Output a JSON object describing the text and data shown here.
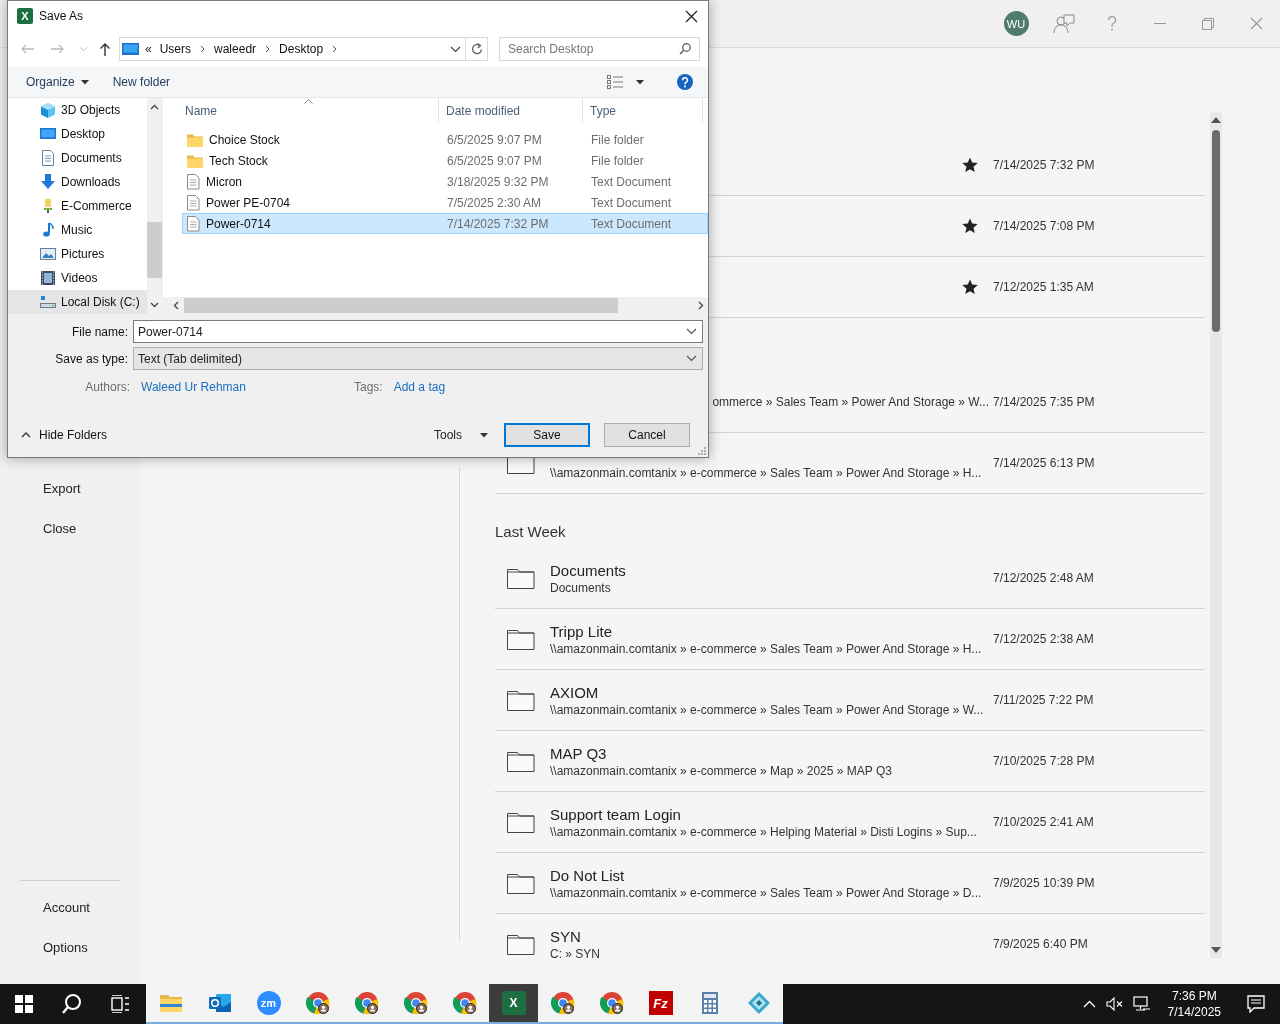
{
  "title_bar": {
    "avatar": "WU"
  },
  "backstage_nav": {
    "items": [
      {
        "label": "Export"
      },
      {
        "label": "Close"
      }
    ],
    "bottom_items": [
      {
        "label": "Account"
      },
      {
        "label": "Options"
      }
    ]
  },
  "recent": {
    "groups": [
      {
        "rows": [
          {
            "kind": "covered",
            "date": "7/14/2025 7:32 PM",
            "pinned": true
          },
          {
            "kind": "covered",
            "date": "7/14/2025 7:08 PM",
            "pinned": true
          },
          {
            "kind": "covered",
            "date": "7/12/2025 1:35 AM",
            "pinned": true
          }
        ]
      },
      {
        "rows": [
          {
            "kind": "cut",
            "path": "ommerce » Sales Team » Power And Storage » W...",
            "date": "7/14/2025 7:35 PM",
            "pinned": false
          },
          {
            "kind": "file",
            "path": "\\\\amazonmain.comtanix » e-commerce » Sales Team » Power And Storage » H...",
            "date": "7/14/2025 6:13 PM",
            "pinned": false
          }
        ]
      },
      {
        "heading": "Last Week",
        "rows": [
          {
            "kind": "file",
            "title": "Documents",
            "path": "Documents",
            "date": "7/12/2025 2:48 AM",
            "pinned": false
          },
          {
            "kind": "file",
            "title": "Tripp Lite",
            "path": "\\\\amazonmain.comtanix » e-commerce » Sales Team » Power And Storage » H...",
            "date": "7/12/2025 2:38 AM",
            "pinned": false
          },
          {
            "kind": "file",
            "title": "AXIOM",
            "path": "\\\\amazonmain.comtanix » e-commerce » Sales Team » Power And Storage » W...",
            "date": "7/11/2025 7:22 PM",
            "pinned": false
          },
          {
            "kind": "file",
            "title": "MAP Q3",
            "path": "\\\\amazonmain.comtanix » e-commerce » Map » 2025 » MAP Q3",
            "date": "7/10/2025 7:28 PM",
            "pinned": false
          },
          {
            "kind": "file",
            "title": "Support team Login",
            "path": "\\\\amazonmain.comtanix » e-commerce » Helping Material » Disti Logins » Sup...",
            "date": "7/10/2025 2:41 AM",
            "pinned": false
          },
          {
            "kind": "file",
            "title": "Do Not List",
            "path": "\\\\amazonmain.comtanix » e-commerce » Sales Team » Power And Storage » D...",
            "date": "7/9/2025 10:39 PM",
            "pinned": false
          },
          {
            "kind": "file",
            "title": "SYN",
            "path": "C: » SYN",
            "date": "7/9/2025 6:40 PM",
            "pinned": false
          }
        ]
      }
    ]
  },
  "dialog": {
    "app_glyph": "X",
    "title": "Save As",
    "overflow_mark": "«",
    "breadcrumb": [
      "Users",
      "waleedr",
      "Desktop"
    ],
    "search": {
      "placeholder": "Search Desktop"
    },
    "toolbar": {
      "organize": "Organize",
      "new_folder": "New folder"
    },
    "nav_items": [
      {
        "label": "3D Objects",
        "kind": "cube",
        "selected": false
      },
      {
        "label": "Desktop",
        "kind": "desktop",
        "selected": false
      },
      {
        "label": "Documents",
        "kind": "documents",
        "selected": false
      },
      {
        "label": "Downloads",
        "kind": "downloads",
        "selected": false
      },
      {
        "label": "E-Commerce",
        "kind": "bulb",
        "selected": false
      },
      {
        "label": "Music",
        "kind": "music",
        "selected": false
      },
      {
        "label": "Pictures",
        "kind": "pictures",
        "selected": false
      },
      {
        "label": "Videos",
        "kind": "videos",
        "selected": false
      },
      {
        "label": "Local Disk (C:)",
        "kind": "disk",
        "selected": true
      }
    ],
    "columns": [
      "Name",
      "Date modified",
      "Type"
    ],
    "files": [
      {
        "kind": "folder",
        "name": "Choice Stock",
        "date": "6/5/2025 9:07 PM",
        "type": "File folder",
        "selected": false
      },
      {
        "kind": "folder",
        "name": "Tech Stock",
        "date": "6/5/2025 9:07 PM",
        "type": "File folder",
        "selected": false
      },
      {
        "kind": "text",
        "name": "Micron",
        "date": "3/18/2025 9:32 PM",
        "type": "Text Document",
        "selected": false
      },
      {
        "kind": "text",
        "name": "Power PE-0704",
        "date": "7/5/2025 2:30 AM",
        "type": "Text Document",
        "selected": false
      },
      {
        "kind": "text",
        "name": "Power-0714",
        "date": "7/14/2025 7:32 PM",
        "type": "Text Document",
        "selected": true
      }
    ],
    "file_name": {
      "label": "File name:",
      "value": "Power-0714"
    },
    "save_type": {
      "label": "Save as type:",
      "value": "Text (Tab delimited)"
    },
    "authors": {
      "label": "Authors:",
      "value": "Waleed Ur Rehman"
    },
    "tags": {
      "label": "Tags:",
      "value": "Add a tag"
    },
    "hide_folders": "Hide Folders",
    "tools": "Tools",
    "buttons": [
      "Save",
      "Cancel"
    ]
  },
  "taskbar": {
    "apps": [
      {
        "kind": "explorer",
        "selected": false
      },
      {
        "kind": "mail",
        "selected": false
      },
      {
        "kind": "meeting",
        "glyph": "zm",
        "selected": false
      },
      {
        "kind": "browser",
        "selected": false
      },
      {
        "kind": "browser",
        "selected": false
      },
      {
        "kind": "browser",
        "selected": false
      },
      {
        "kind": "browser",
        "selected": false
      },
      {
        "kind": "spreadsheet",
        "glyph": "X",
        "selected": true
      },
      {
        "kind": "browser",
        "selected": false
      },
      {
        "kind": "browser",
        "selected": false
      },
      {
        "kind": "ftp",
        "glyph": "Fz",
        "selected": false
      },
      {
        "kind": "calculator",
        "selected": false
      },
      {
        "kind": "diamond",
        "selected": false
      }
    ],
    "time": "7:36 PM",
    "date": "7/14/2025"
  }
}
